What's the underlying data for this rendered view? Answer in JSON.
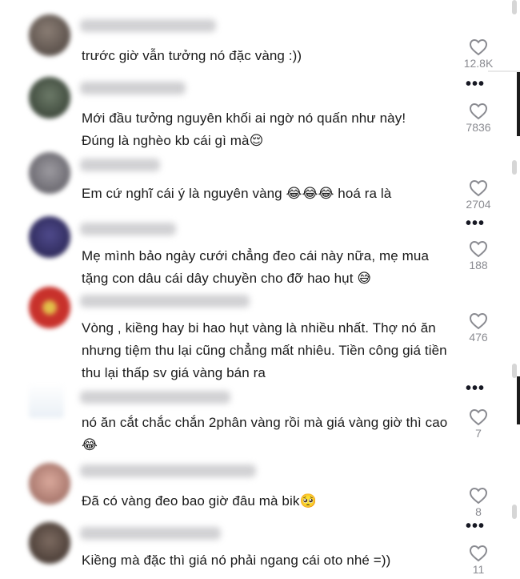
{
  "colors": {
    "text": "#1a1a1a",
    "muted": "#8a8b91",
    "background": "#ffffff"
  },
  "icons": {
    "like": "heart-outline-icon",
    "more": "more-dots-icon"
  },
  "comments": [
    {
      "text": "trước giờ vẫn tưởng nó đặc vàng :))",
      "likes": "12.8K"
    },
    {
      "text": "Mới đầu tưởng nguyên khối ai ngờ nó quấn như này! Đúng là nghèo kb cái gì mà😌",
      "likes": "7836"
    },
    {
      "text": "Em cứ nghĩ cái ý là nguyên vàng 😂😂😂  hoá ra là",
      "likes": "2704"
    },
    {
      "text": "Mẹ mình bảo ngày cưới chẳng đeo cái này nữa, mẹ mua tặng con dâu cái dây chuyền cho đỡ hao hụt 😅",
      "likes": "188"
    },
    {
      "text": "Vòng , kiềng hay bi hao hụt vàng là nhiều nhất. Thợ nó ăn nhưng tiệm thu lại cũng chẳng mất nhiêu. Tiền công giá tiền thu lại thấp sv giá vàng bán ra",
      "likes": "476"
    },
    {
      "text": "nó ăn cắt chắc chắn 2phân vàng rồi mà giá vàng giờ thì cao 😂",
      "likes": "7"
    },
    {
      "text": "Đã có vàng đeo bao giờ đâu mà bik🥺",
      "likes": "8"
    },
    {
      "text": "Kiềng mà đặc thì giá nó phải ngang cái oto nhé =))",
      "likes": "11"
    }
  ],
  "more_label": "•••"
}
